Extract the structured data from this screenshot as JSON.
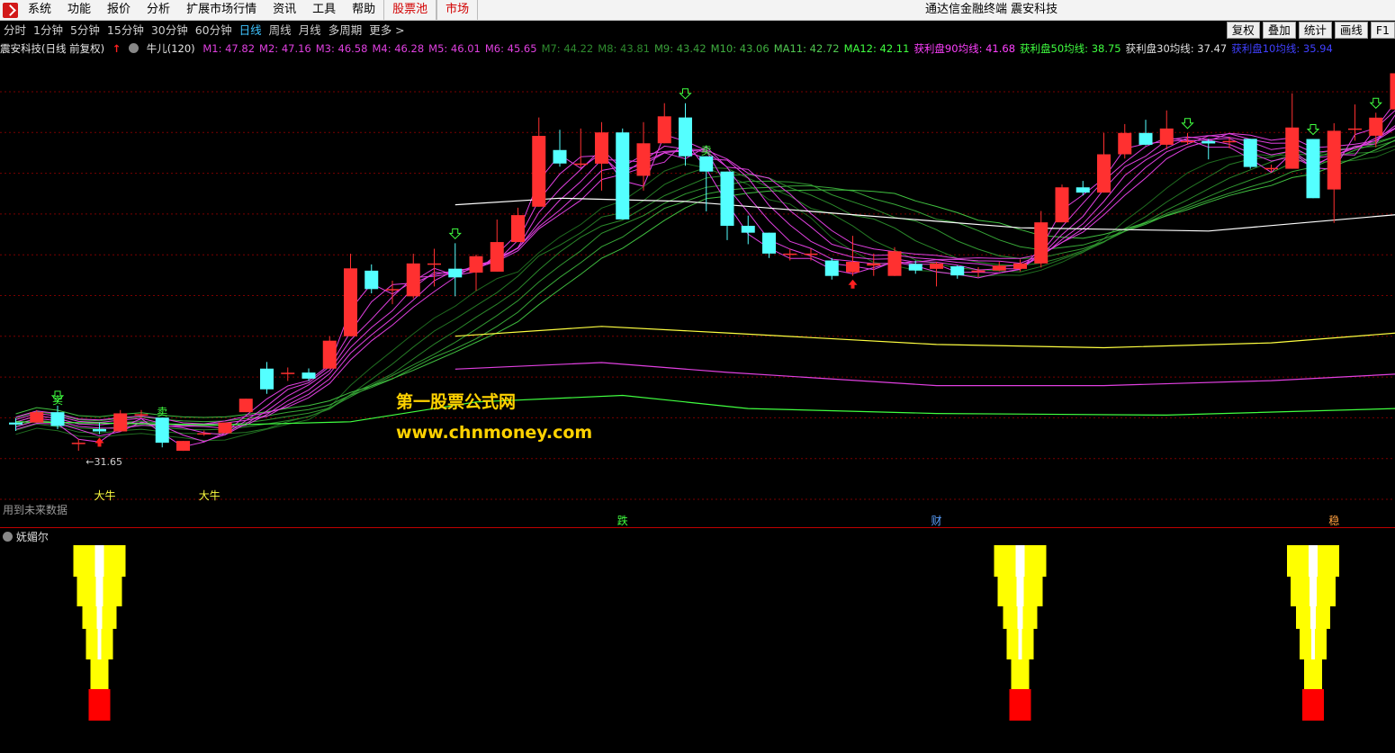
{
  "menu": {
    "items": [
      "系统",
      "功能",
      "报价",
      "分析",
      "扩展市场行情",
      "资讯",
      "工具",
      "帮助"
    ],
    "highlight_items": [
      "股票池",
      "市场"
    ],
    "app_title": "通达信金融终端 震安科技"
  },
  "toolbar": {
    "periods": [
      "分时",
      "1分钟",
      "5分钟",
      "15分钟",
      "30分钟",
      "60分钟",
      "日线",
      "周线",
      "月线",
      "多周期",
      "更多 >"
    ],
    "active_period": "日线",
    "right_buttons": [
      "复权",
      "叠加",
      "统计",
      "画线",
      "F1"
    ]
  },
  "legend": {
    "stock": "震安科技(日线 前复权)",
    "indicator": "牛儿(120)",
    "items": [
      {
        "text": "M1: 47.82",
        "color": "#e040e0"
      },
      {
        "text": "M2: 47.16",
        "color": "#e040e0"
      },
      {
        "text": "M3: 46.58",
        "color": "#e040e0"
      },
      {
        "text": "M4: 46.28",
        "color": "#e040e0"
      },
      {
        "text": "M5: 46.01",
        "color": "#e040e0"
      },
      {
        "text": "M6: 45.65",
        "color": "#e040e0"
      },
      {
        "text": "M7: 44.22",
        "color": "#2e8b2e"
      },
      {
        "text": "M8: 43.81",
        "color": "#2e8b2e"
      },
      {
        "text": "M9: 43.42",
        "color": "#3aa03a"
      },
      {
        "text": "M10: 43.06",
        "color": "#40b040"
      },
      {
        "text": "MA11: 42.72",
        "color": "#50c850"
      },
      {
        "text": "MA12: 42.11",
        "color": "#40ff40"
      },
      {
        "text": "获利盘90均线: 41.68",
        "color": "#ff40ff"
      },
      {
        "text": "获利盘50均线: 38.75",
        "color": "#40ff40"
      },
      {
        "text": "获利盘30均线: 37.47",
        "color": "#e0e0e0"
      },
      {
        "text": "获利盘10均线: 35.94",
        "color": "#4040ff"
      }
    ]
  },
  "chart_data": {
    "type": "candlestick",
    "price_low_label": "31.65",
    "candles": [
      {
        "o": 33.35,
        "c": 33.23,
        "h": 33.61,
        "l": 32.84
      },
      {
        "o": 33.35,
        "c": 33.98,
        "h": 34.11,
        "l": 33.35
      },
      {
        "o": 33.98,
        "c": 33.14,
        "h": 34.38,
        "l": 32.95
      },
      {
        "o": 32.12,
        "c": 32.12,
        "h": 32.35,
        "l": 31.63
      },
      {
        "o": 32.95,
        "c": 32.81,
        "h": 33.35,
        "l": 32.65
      },
      {
        "o": 32.81,
        "c": 33.91,
        "h": 34.11,
        "l": 32.81
      },
      {
        "o": 33.86,
        "c": 33.86,
        "h": 34.11,
        "l": 33.65
      },
      {
        "o": 33.65,
        "c": 32.12,
        "h": 33.65,
        "l": 31.84
      },
      {
        "o": 31.63,
        "c": 32.23,
        "h": 32.23,
        "l": 31.63
      },
      {
        "o": 32.7,
        "c": 32.7,
        "h": 32.86,
        "l": 32.54
      },
      {
        "o": 32.7,
        "c": 33.35,
        "h": 33.35,
        "l": 32.7
      },
      {
        "o": 33.98,
        "c": 34.8,
        "h": 34.8,
        "l": 33.98
      },
      {
        "o": 36.63,
        "c": 35.37,
        "h": 37.03,
        "l": 35.1
      },
      {
        "o": 36.38,
        "c": 36.38,
        "h": 36.7,
        "l": 35.88
      },
      {
        "o": 36.39,
        "c": 36.02,
        "h": 36.64,
        "l": 35.88
      },
      {
        "o": 36.63,
        "c": 38.33,
        "h": 38.6,
        "l": 36.63
      },
      {
        "o": 38.6,
        "c": 42.73,
        "h": 43.62,
        "l": 38.6
      },
      {
        "o": 42.59,
        "c": 41.47,
        "h": 42.97,
        "l": 41.21
      },
      {
        "o": 41.47,
        "c": 41.47,
        "h": 41.98,
        "l": 40.55
      },
      {
        "o": 41.03,
        "c": 43.03,
        "h": 43.62,
        "l": 40.9
      },
      {
        "o": 43.03,
        "c": 43.03,
        "h": 43.92,
        "l": 41.63
      },
      {
        "o": 42.71,
        "c": 42.18,
        "h": 44.26,
        "l": 41.03
      },
      {
        "o": 42.47,
        "c": 43.47,
        "h": 43.57,
        "l": 41.37
      },
      {
        "o": 42.53,
        "c": 44.33,
        "h": 45.7,
        "l": 42.53
      },
      {
        "o": 44.33,
        "c": 45.97,
        "h": 46.42,
        "l": 44.33
      },
      {
        "o": 46.48,
        "c": 50.79,
        "h": 51.91,
        "l": 46.48
      },
      {
        "o": 49.93,
        "c": 49.11,
        "h": 51.16,
        "l": 48.92
      },
      {
        "o": 49.11,
        "c": 49.11,
        "h": 51.24,
        "l": 48.88
      },
      {
        "o": 49.1,
        "c": 51.0,
        "h": 51.63,
        "l": 47.46
      },
      {
        "o": 51.0,
        "c": 45.71,
        "h": 51.24,
        "l": 45.71
      },
      {
        "o": 48.36,
        "c": 50.34,
        "h": 51.63,
        "l": 47.46
      },
      {
        "o": 50.34,
        "c": 51.98,
        "h": 52.78,
        "l": 50.34
      },
      {
        "o": 51.91,
        "c": 49.55,
        "h": 52.78,
        "l": 48.97
      },
      {
        "o": 49.55,
        "c": 48.62,
        "h": 49.55,
        "l": 46.2
      },
      {
        "o": 48.62,
        "c": 45.32,
        "h": 48.62,
        "l": 44.45
      },
      {
        "o": 45.32,
        "c": 44.9,
        "h": 45.94,
        "l": 44.2
      },
      {
        "o": 44.9,
        "c": 43.63,
        "h": 44.9,
        "l": 43.36
      },
      {
        "o": 43.63,
        "c": 43.63,
        "h": 43.92,
        "l": 43.21
      },
      {
        "o": 43.63,
        "c": 43.63,
        "h": 43.92,
        "l": 43.21
      },
      {
        "o": 43.21,
        "c": 42.27,
        "h": 43.36,
        "l": 42.05
      },
      {
        "o": 42.49,
        "c": 43.13,
        "h": 44.71,
        "l": 42.27
      },
      {
        "o": 42.9,
        "c": 43.03,
        "h": 43.63,
        "l": 42.27
      },
      {
        "o": 42.27,
        "c": 43.77,
        "h": 44.02,
        "l": 42.27
      },
      {
        "o": 43.0,
        "c": 42.6,
        "h": 43.2,
        "l": 42.4
      },
      {
        "o": 42.7,
        "c": 43.03,
        "h": 43.13,
        "l": 41.63
      },
      {
        "o": 42.86,
        "c": 42.3,
        "h": 42.92,
        "l": 42.1
      },
      {
        "o": 42.5,
        "c": 42.6,
        "h": 42.8,
        "l": 42.2
      },
      {
        "o": 42.6,
        "c": 42.9,
        "h": 43.13,
        "l": 42.55
      },
      {
        "o": 42.7,
        "c": 43.03,
        "h": 43.27,
        "l": 42.55
      },
      {
        "o": 43.03,
        "c": 45.53,
        "h": 46.22,
        "l": 42.78
      },
      {
        "o": 45.53,
        "c": 47.66,
        "h": 47.83,
        "l": 45.53
      },
      {
        "o": 47.66,
        "c": 47.34,
        "h": 48.05,
        "l": 47.17
      },
      {
        "o": 47.34,
        "c": 49.67,
        "h": 50.97,
        "l": 47.34
      },
      {
        "o": 49.67,
        "c": 50.97,
        "h": 51.51,
        "l": 49.41
      },
      {
        "o": 50.97,
        "c": 50.25,
        "h": 51.77,
        "l": 50.21
      },
      {
        "o": 50.25,
        "c": 51.24,
        "h": 52.34,
        "l": 49.97
      },
      {
        "o": 50.48,
        "c": 50.48,
        "h": 50.97,
        "l": 50.25
      },
      {
        "o": 50.48,
        "c": 50.33,
        "h": 50.61,
        "l": 49.36
      },
      {
        "o": 50.48,
        "c": 50.48,
        "h": 50.69,
        "l": 50.04
      },
      {
        "o": 50.61,
        "c": 48.9,
        "h": 50.61,
        "l": 48.79
      },
      {
        "o": 48.84,
        "c": 48.84,
        "h": 49.04,
        "l": 48.58
      },
      {
        "o": 48.79,
        "c": 51.3,
        "h": 53.38,
        "l": 48.79
      },
      {
        "o": 50.6,
        "c": 47.0,
        "h": 50.6,
        "l": 47.0
      },
      {
        "o": 47.53,
        "c": 51.1,
        "h": 51.56,
        "l": 45.5
      },
      {
        "o": 51.24,
        "c": 51.24,
        "h": 52.7,
        "l": 50.5
      },
      {
        "o": 50.8,
        "c": 51.9,
        "h": 52.2,
        "l": 50.1
      },
      {
        "o": 52.4,
        "c": 54.6,
        "h": 54.6,
        "l": 52.4
      }
    ],
    "signal_labels": [
      {
        "text": "卖",
        "color": "#40ff40",
        "i": 2
      },
      {
        "text": "卖",
        "color": "#40ff40",
        "i": 7
      },
      {
        "text": "卖",
        "color": "#40ff40",
        "i": 33
      },
      {
        "text": "大牛",
        "color": "#ffff40",
        "i": 4
      },
      {
        "text": "大牛",
        "color": "#ffff40",
        "i": 9
      }
    ],
    "bottom_markers": [
      {
        "text": "跌",
        "color": "#40ff40",
        "i": 29
      },
      {
        "text": "财",
        "color": "#5aa0ff",
        "i": 44
      },
      {
        "text": "稳",
        "color": "#ffa040",
        "i": 63
      }
    ],
    "sub_indicator_bars": [
      4,
      48,
      62
    ]
  },
  "overlay": {
    "watermark_line1": "第一股票公式网",
    "watermark_line2": "www.chnmoney.com",
    "future_note": "用到未来数据",
    "sub_title": "妩媚尔"
  },
  "colors": {
    "up": "#ff3030",
    "down": "#54ffff",
    "grid": "#7a0000",
    "ma_fast": "#e040e0",
    "ma_slow": "#2e9b2e",
    "white_line": "#ffffff",
    "yellow_line": "#ffff40",
    "magenta_line": "#e040e0",
    "green_line": "#40ff40"
  }
}
